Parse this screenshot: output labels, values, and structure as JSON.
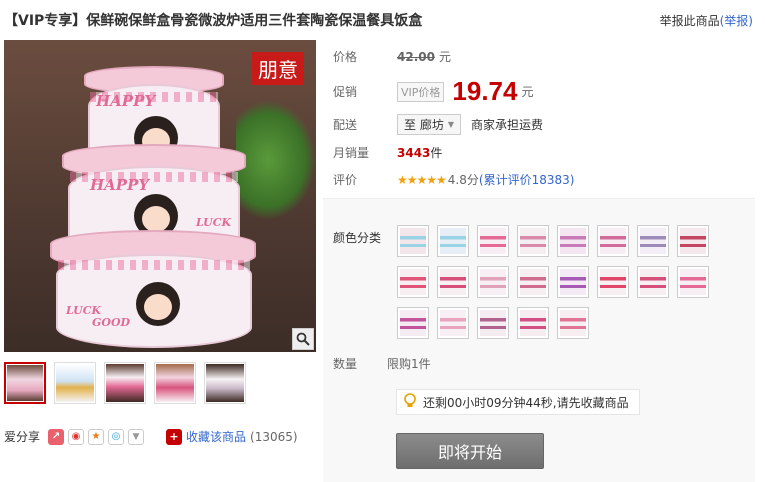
{
  "product": {
    "title": "【VIP专享】保鲜碗保鲜盒骨瓷微波炉适用三件套陶瓷保温餐具饭盒",
    "report_text": "举报此商品",
    "report_link": "(举报)",
    "brand_tag": "朋意",
    "image_labels": [
      "HAPPY",
      "LUCK",
      "GOOD"
    ]
  },
  "info": {
    "price_label": "价格",
    "price_old": "42.00",
    "price_unit": "元",
    "promo_label": "促销",
    "vip_tag": "VIP价格",
    "price_new": "19.74",
    "promo_unit": "元",
    "ship_label": "配送",
    "ship_dest": "至 廊坊",
    "ship_note": "商家承担运费",
    "sales_label": "月销量",
    "sales_value": "3443",
    "sales_unit": "件",
    "rating_label": "评价",
    "stars": "★★★★★",
    "score": "4.8分",
    "rating_link": "(累计评价18383)"
  },
  "options": {
    "color_label": "颜色分类",
    "swatch_count": 21,
    "qty_label": "数量",
    "limit": "限购1件",
    "notice": "还剩00小时09分钟44秒,请先收藏商品",
    "cta": "即将开始"
  },
  "share": {
    "label": "爱分享",
    "fav_link": "收藏该商品",
    "fav_count": "(13065)"
  },
  "colors": {
    "accent": "#c40000",
    "link": "#3366cc",
    "brand_tag": "#c91a1a"
  }
}
